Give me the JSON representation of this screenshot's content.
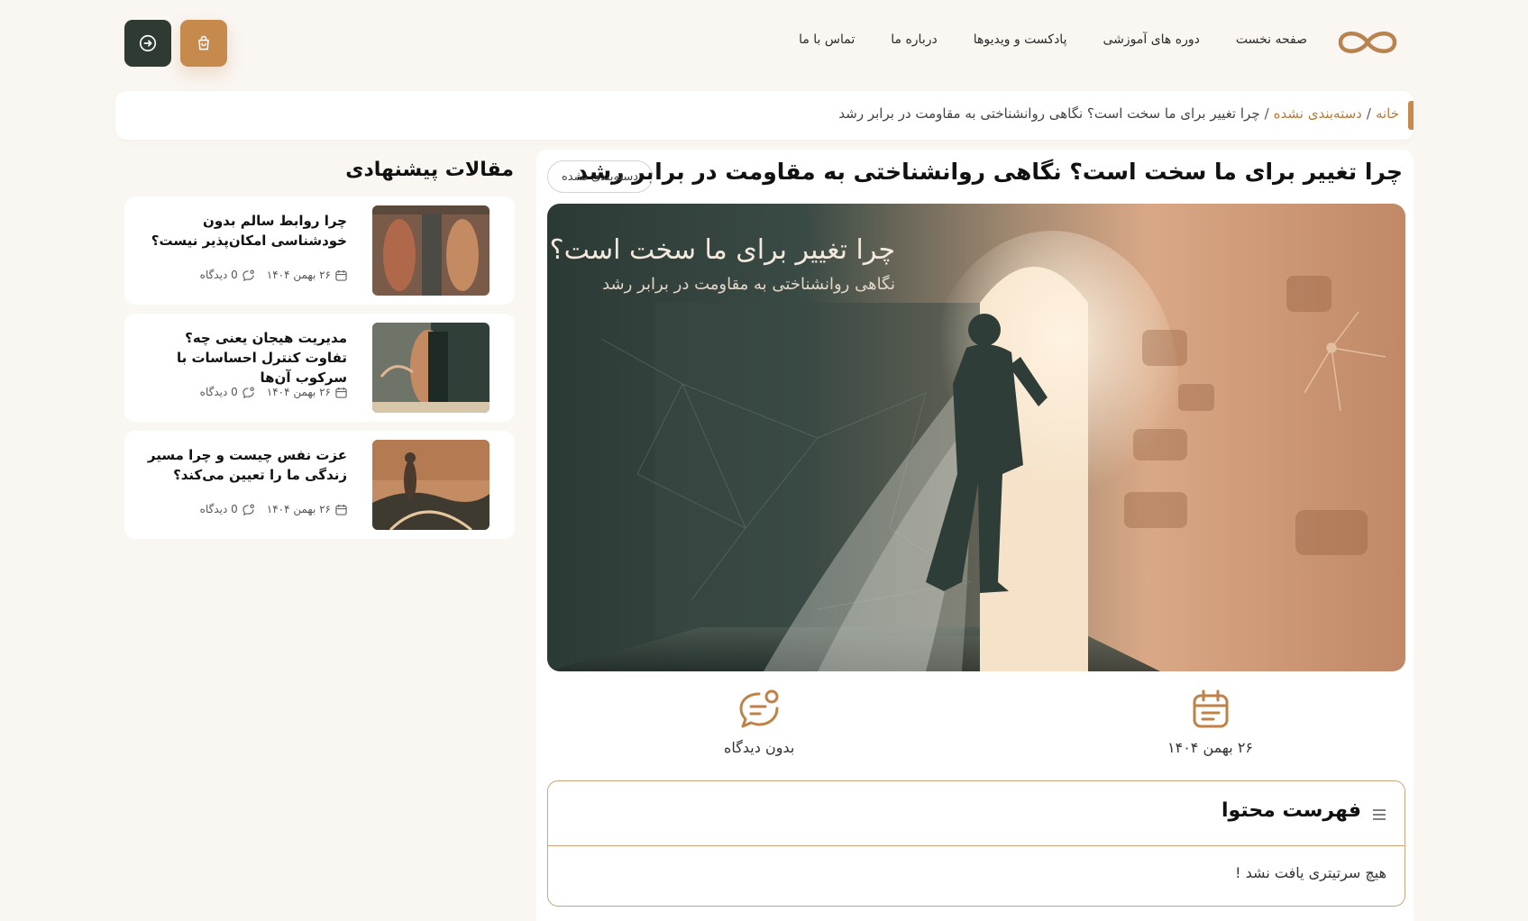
{
  "nav": {
    "items": [
      "صفحه نخست",
      "دوره های آموزشی",
      "پادکست و ویدیوها",
      "درباره ما",
      "تماس با ما"
    ]
  },
  "breadcrumb": {
    "home": "خانه",
    "category": "دسته‌بندی نشده",
    "current": "چرا تغییر برای ما سخت است؟ نگاهی روانشناختی به مقاومت در برابر رشد"
  },
  "post": {
    "title": "چرا تغییر برای ما سخت است؟ نگاهی روانشناختی به مقاومت در برابر رشد",
    "category": "دسته‌بندی نشده",
    "hero_title": "چرا تغییر برای ما سخت است؟",
    "hero_subtitle": "نگاهی روانشناختی به مقاومت در برابر رشد",
    "date": "۲۶ بهمن ۱۴۰۴",
    "comments": "بدون دیدگاه"
  },
  "toc": {
    "title": "فهرست محتوا",
    "empty": "هیچ سرتیتری یافت نشد !"
  },
  "sidebar": {
    "title": "مقالات پیشنهادی",
    "items": [
      {
        "title": "چرا روابط سالم بدون خودشناسی امکان‌پذیر نیست؟",
        "date": "۲۶ بهمن ۱۴۰۴",
        "comments": "0 دیدگاه"
      },
      {
        "title": "مدیریت هیجان یعنی چه؟ تفاوت کنترل احساسات با سرکوب آن‌ها",
        "date": "۲۶ بهمن ۱۴۰۴",
        "comments": "0 دیدگاه"
      },
      {
        "title": "عزت نفس چیست و چرا مسیر زندگی ما را تعیین می‌کند؟",
        "date": "۲۶ بهمن ۱۴۰۴",
        "comments": "0 دیدگاه"
      }
    ]
  },
  "colors": {
    "accent": "#c68a4c",
    "dark_button": "#2f3a33",
    "background": "#faf6f2"
  }
}
